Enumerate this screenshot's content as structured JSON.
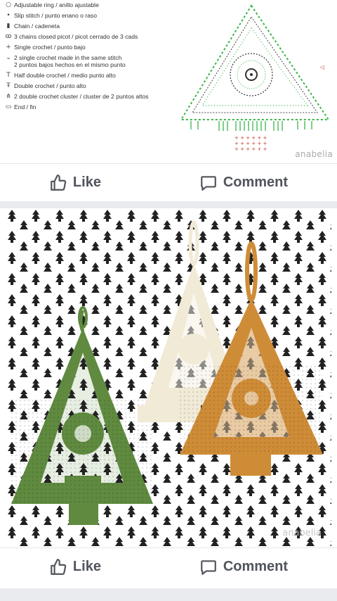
{
  "post1": {
    "legend": [
      {
        "icon": "circle-icon",
        "glyph": "○",
        "text": "Adjustable ring / anillo ajustable"
      },
      {
        "icon": "dot-icon",
        "glyph": "•",
        "text": "Slip stitch / punto enano o raso"
      },
      {
        "icon": "chain-icon",
        "glyph": "▮",
        "text": "Chain / cadeneta"
      },
      {
        "icon": "picot-icon",
        "glyph": "ꝏ",
        "text": "3 chains closed picot / picot cerrado de 3 cads"
      },
      {
        "icon": "plus-icon",
        "glyph": "+",
        "text": "Single crochet / punto bajo"
      },
      {
        "icon": "v-icon",
        "glyph": "⌄",
        "text": "2 single crochet made in the same stitch\n2 puntos bajos hechos en el mismo punto"
      },
      {
        "icon": "hdc-icon",
        "glyph": "T",
        "text": "Half double crochet / medio punto alto"
      },
      {
        "icon": "dc-icon",
        "glyph": "Ŧ",
        "text": "Double crochet / punto alto"
      },
      {
        "icon": "cluster-icon",
        "glyph": "⋔",
        "text": "2 double crochet cluster / cluster de 2 puntos altos"
      },
      {
        "icon": "end-icon",
        "glyph": "▭",
        "text": "End / fin"
      }
    ],
    "watermark": "anabelia",
    "like_label": "Like",
    "comment_label": "Comment"
  },
  "post2": {
    "watermark": "anabelia",
    "like_label": "Like",
    "comment_label": "Comment"
  },
  "colors": {
    "green_yarn": "#5f8a3f",
    "cream_yarn": "#f1ead6",
    "mustard_yarn": "#cf8c37",
    "chart_green": "#39b54a",
    "chart_red": "#c0392b",
    "action_gray": "#50545c"
  }
}
